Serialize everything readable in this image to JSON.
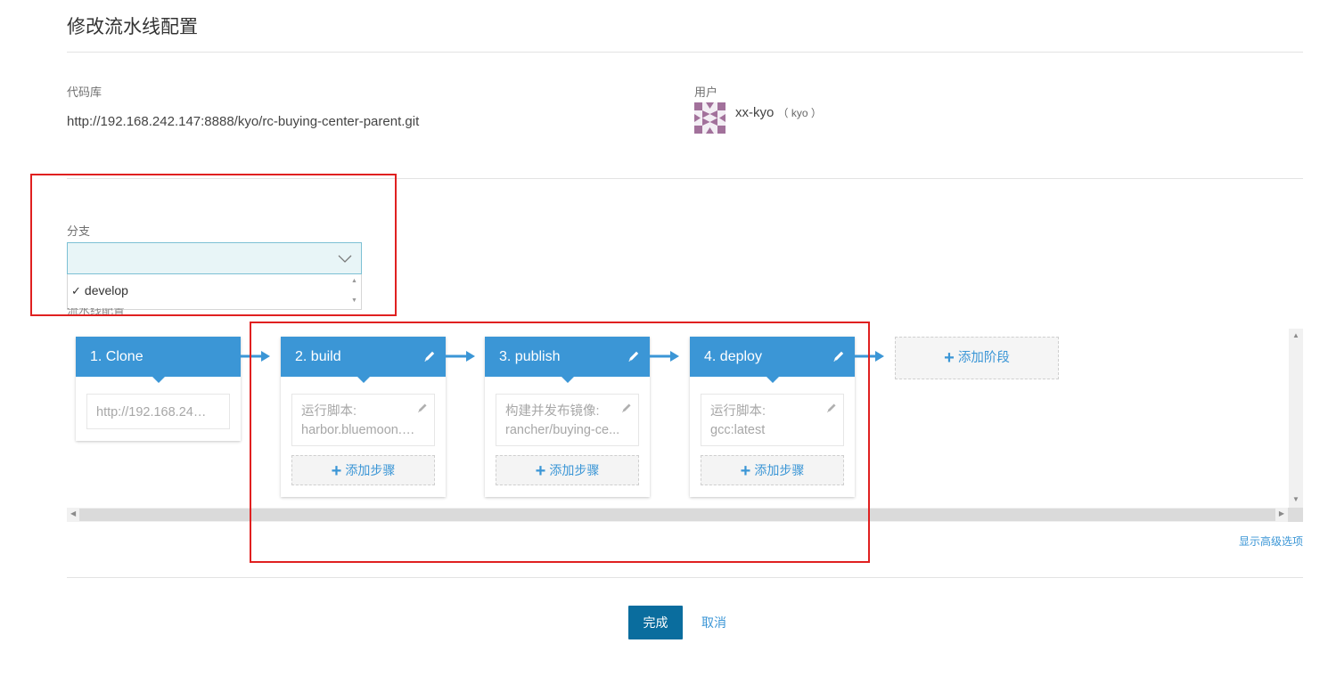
{
  "page": {
    "title": "修改流水线配置"
  },
  "repo": {
    "label": "代码库",
    "url": "http://192.168.242.147:8888/kyo/rc-buying-center-parent.git"
  },
  "user": {
    "label": "用户",
    "name": "xx-kyo",
    "login": "（ kyo ）",
    "avatar_icon": "identicon-avatar"
  },
  "branch": {
    "label": "分支",
    "selected": "",
    "options": [
      {
        "label": "develop",
        "checked": true
      }
    ]
  },
  "pipeline": {
    "label": "流水线配置",
    "stages": [
      {
        "name": "1. Clone",
        "editable": false,
        "steps": [
          {
            "lines": [
              "http://192.168.242.1..."
            ]
          }
        ],
        "add_step": ""
      },
      {
        "name": "2. build",
        "editable": true,
        "steps": [
          {
            "lines": [
              "运行脚本:",
              "harbor.bluemoon.c..."
            ]
          }
        ],
        "add_step": "添加步骤"
      },
      {
        "name": "3. publish",
        "editable": true,
        "steps": [
          {
            "lines": [
              "构建并发布镜像:",
              "rancher/buying-ce..."
            ]
          }
        ],
        "add_step": "添加步骤"
      },
      {
        "name": "4. deploy",
        "editable": true,
        "steps": [
          {
            "lines": [
              "运行脚本:",
              "gcc:latest"
            ]
          }
        ],
        "add_step": "添加步骤"
      }
    ],
    "add_stage": "添加阶段",
    "advanced_link": "显示高级选项"
  },
  "actions": {
    "done": "完成",
    "cancel": "取消"
  },
  "colors": {
    "accent": "#3b96d6",
    "primary_button": "#0a6d9e",
    "highlight_outline": "#e02020"
  }
}
